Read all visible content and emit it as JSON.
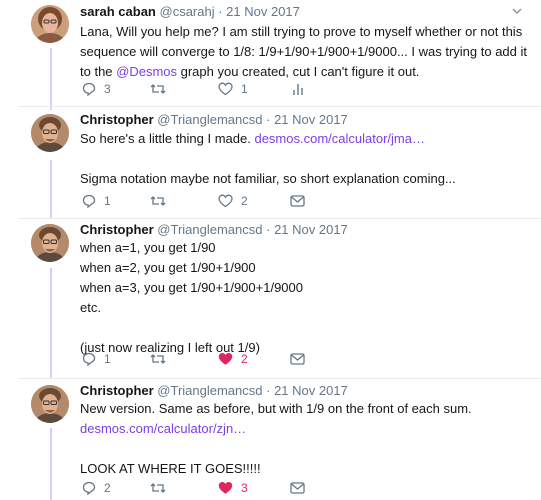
{
  "tweets": [
    {
      "name": "sarah caban",
      "handle": "@csarahj",
      "date": "· 21 Nov 2017",
      "lines": [
        {
          "text": "Lana, Will you help me? I am still trying to prove to myself whether or not this"
        },
        {
          "text": "sequence will converge to 1/8: 1/9+1/90+1/900+1/9000... I was trying to add it"
        },
        {
          "pre": "to the ",
          "link": "@Desmos",
          "post": " graph you created, cut I can't figure it out."
        }
      ],
      "replies": "3",
      "likes": "1",
      "liked": false
    },
    {
      "name": "Christopher",
      "handle": "@Trianglemancsd",
      "date": "· 21 Nov 2017",
      "lines": [
        {
          "pre": "So here's a little thing I made. ",
          "link": "desmos.com/calculator/jma…",
          "post": ""
        },
        {
          "text": ""
        },
        {
          "text": "Sigma notation maybe not familiar, so short explanation coming..."
        }
      ],
      "replies": "1",
      "likes": "2",
      "liked": false
    },
    {
      "name": "Christopher",
      "handle": "@Trianglemancsd",
      "date": "· 21 Nov 2017",
      "lines": [
        {
          "text": "when a=1, you get 1/90"
        },
        {
          "text": "when a=2, you get 1/90+1/900"
        },
        {
          "text": "when a=3, you get 1/90+1/900+1/9000"
        },
        {
          "text": "etc."
        },
        {
          "text": ""
        },
        {
          "text": "(just now realizing I left out 1/9)"
        }
      ],
      "replies": "1",
      "likes": "2",
      "liked": true
    },
    {
      "name": "Christopher",
      "handle": "@Trianglemancsd",
      "date": "· 21 Nov 2017",
      "lines": [
        {
          "text": "New version. Same as before, but with 1/9 on the front of each sum."
        },
        {
          "pre": "",
          "link": "desmos.com/calculator/zjn…",
          "post": ""
        },
        {
          "text": ""
        },
        {
          "text": "LOOK AT WHERE IT GOES!!!!!"
        }
      ],
      "replies": "2",
      "likes": "3",
      "liked": true
    }
  ],
  "icons": {
    "reply": "reply-icon",
    "retweet": "retweet-icon",
    "like": "heart-icon",
    "message": "envelope-icon",
    "analytics": "analytics-icon",
    "more": "chevron-down-icon"
  },
  "colors": {
    "thread_line": "#d6ccff",
    "link": "#7b3fe4",
    "like_active": "#e0245e",
    "muted": "#657786"
  }
}
